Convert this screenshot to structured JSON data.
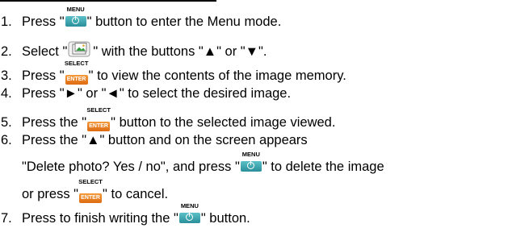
{
  "icons": {
    "menu": {
      "label": "MENU",
      "name": "menu-power-icon"
    },
    "enter": {
      "label": "SELECT",
      "button_text": "ENTER",
      "name": "select-enter-icon"
    },
    "image": {
      "name": "image-gallery-icon"
    }
  },
  "steps": [
    {
      "num": "1.",
      "before": "Press \"",
      "after": "\" button to enter the Menu mode."
    },
    {
      "num": "2.",
      "before": "Select \"",
      "after": "\" with the buttons \"▲\" or \"▼\"."
    },
    {
      "num": "3.",
      "before": "Press \"",
      "after": "\" to view the contents of the image memory."
    },
    {
      "num": "4.",
      "text": "Press \"►\" or \"◄\" to select the desired image."
    },
    {
      "num": "5.",
      "before": "Press the \"",
      "after": "\" button to the selected image viewed."
    },
    {
      "num": "6.",
      "text": "Press the \"▲\" button and on the screen appears",
      "line2_before": "\"Delete photo? Yes / no\", and press \"",
      "line2_after": "\" to delete the image",
      "line3_before": "or press \"",
      "line3_after": "\" to cancel."
    },
    {
      "num": "7.",
      "before": "Press to finish writing the \"",
      "after": "\" button."
    }
  ],
  "colors": {
    "menu_button": "#3aa6b0",
    "enter_button": "#ec7d22",
    "text": "#000000"
  }
}
